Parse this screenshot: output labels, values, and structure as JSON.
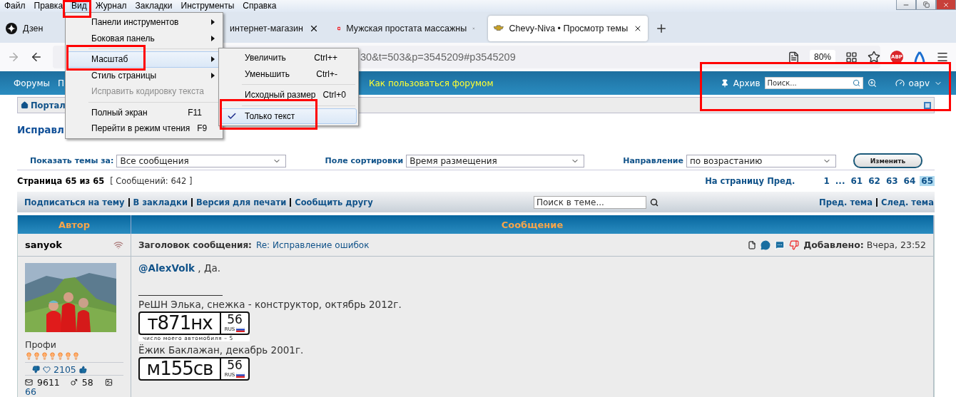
{
  "menu_bar": [
    {
      "label": "Файл",
      "selected": false
    },
    {
      "label": "Правка",
      "selected": false
    },
    {
      "label": "Вид",
      "selected": true
    },
    {
      "label": "Журнал",
      "selected": false
    },
    {
      "label": "Закладки",
      "selected": false
    },
    {
      "label": "Инструменты",
      "selected": false
    },
    {
      "label": "Справка",
      "selected": false
    }
  ],
  "tabs": [
    {
      "label": "Дзен",
      "kind": "dzen",
      "selected": false
    },
    {
      "label": "интернет-магазин",
      "kind": "plain",
      "selected": false
    },
    {
      "label": "Мужская простата массажны",
      "kind": "red",
      "selected": false
    },
    {
      "label": "Chevy-Niva • Просмотр темы",
      "kind": "chevy",
      "selected": true
    }
  ],
  "toolbar": {
    "url": "30&t=503&p=3545209#p3545209",
    "zoom": "80%",
    "adblock": "ABP"
  },
  "forum_nav": {
    "items": [
      "Форумы",
      "П"
    ],
    "highlight": "Как пользоваться форумом",
    "archive": "Архив",
    "search_placeholder": "Поиск...",
    "user": "oapv"
  },
  "breadcrumb": "Портал",
  "page_title": "Исправл",
  "filters": [
    {
      "label": "Показать темы за:",
      "value": "Все сообщения"
    },
    {
      "label": "Поле сортировки",
      "value": "Время размещения"
    },
    {
      "label": "Направление",
      "value": "по возрастанию"
    }
  ],
  "apply_button": "Изменить",
  "pagination": {
    "page_info": "Страница 65 из 65",
    "count": "[ Сообщений: 642 ]",
    "goto": "На страницу",
    "prev": "Пред.",
    "pages": [
      {
        "label": "1",
        "selected": false
      },
      {
        "label": "...",
        "selected": false
      },
      {
        "label": "61",
        "selected": false
      },
      {
        "label": "62",
        "selected": false
      },
      {
        "label": "63",
        "selected": false
      },
      {
        "label": "64",
        "selected": false
      },
      {
        "label": "65",
        "selected": true
      }
    ]
  },
  "actions": [
    "Подписаться на тему",
    "В закладки",
    "Версия для печати",
    "Сообщить другу"
  ],
  "topic_search": {
    "placeholder": "Поиск в теме..."
  },
  "topic_nav": [
    "Пред. тема",
    "След. тема"
  ],
  "table": {
    "columns": [
      "Автор",
      "Сообщение"
    ]
  },
  "post": {
    "author": "sanyok",
    "subject_label": "Заголовок сообщения:",
    "subject": "Re: Исправление ошибок",
    "posted_label": "Добавлено:",
    "posted": "Вчера, 23:52",
    "rank": "Профи",
    "stars": 7,
    "likes": "2105",
    "messages": "9611",
    "age": "58",
    "extra": "66",
    "mention": "@AlexVolk",
    "text": " , Да.",
    "signature": [
      {
        "kind": "text",
        "text": "РеШН Элька, снежка - конструктор, октябрь 2012г."
      },
      {
        "kind": "plate",
        "number": "т871нх",
        "region": "56",
        "country": "RUS",
        "caption": "число моего автомобиля – 5"
      },
      {
        "kind": "text",
        "text": "Ёжик Баклажан, декабрь 2001г."
      },
      {
        "kind": "plate",
        "number": "м155св",
        "region": "56",
        "country": "RUS"
      }
    ]
  },
  "view_menu": [
    {
      "kind": "submenu",
      "label": "Панели инструментов",
      "selected": false,
      "disabled": false
    },
    {
      "kind": "submenu",
      "label": "Боковая панель",
      "selected": false,
      "disabled": false
    },
    {
      "kind": "separator"
    },
    {
      "kind": "submenu",
      "label": "Масштаб",
      "selected": true,
      "disabled": false
    },
    {
      "kind": "submenu",
      "label": "Стиль страницы",
      "selected": false,
      "disabled": false
    },
    {
      "kind": "item",
      "label": "Исправить кодировку текста",
      "selected": false,
      "disabled": true
    },
    {
      "kind": "separator"
    },
    {
      "kind": "item",
      "label": "Полный экран",
      "shortcut": "F11",
      "selected": false,
      "disabled": false
    },
    {
      "kind": "item",
      "label": "Перейти в режим чтения",
      "shortcut": "F9",
      "selected": false,
      "disabled": false
    }
  ],
  "zoom_menu": [
    {
      "kind": "item",
      "label": "Увеличить",
      "shortcut": "Ctrl++",
      "selected": false,
      "checked": false
    },
    {
      "kind": "item",
      "label": "Уменьшить",
      "shortcut": "Ctrl+-",
      "selected": false,
      "checked": false
    },
    {
      "kind": "separator"
    },
    {
      "kind": "item",
      "label": "Исходный размер",
      "shortcut": "Ctrl+0",
      "selected": false,
      "checked": false
    },
    {
      "kind": "separator"
    },
    {
      "kind": "item",
      "label": "Только текст",
      "selected": true,
      "checked": true
    }
  ]
}
